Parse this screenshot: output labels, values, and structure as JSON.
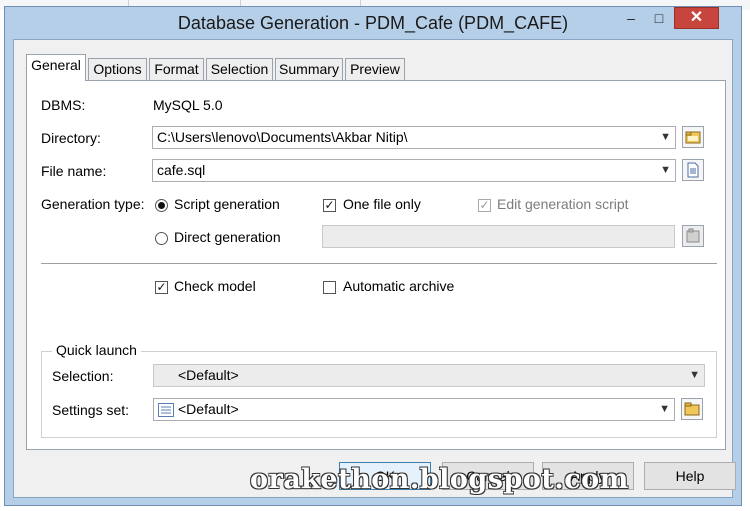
{
  "window": {
    "title": "Database Generation - PDM_Cafe (PDM_CAFE)"
  },
  "titlebar_buttons": {
    "minimize": "–",
    "maximize": "□",
    "close": "✕"
  },
  "tabs": [
    "General",
    "Options",
    "Format",
    "Selection",
    "Summary",
    "Preview"
  ],
  "active_tab": "General",
  "general": {
    "dbms_label": "DBMS:",
    "dbms_value": "MySQL 5.0",
    "directory_label": "Directory:",
    "directory_value": "C:\\Users\\lenovo\\Documents\\Akbar Nitip\\",
    "filename_label": "File name:",
    "filename_value": "cafe.sql",
    "generation_type_label": "Generation type:",
    "script_generation_label": "Script generation",
    "direct_generation_label": "Direct generation",
    "one_file_only_label": "One file only",
    "edit_script_label": "Edit generation script",
    "direct_generation_value": "",
    "check_model_label": "Check model",
    "automatic_archive_label": "Automatic archive"
  },
  "state": {
    "generation_type": "script",
    "one_file_only": true,
    "edit_generation_script": true,
    "edit_generation_script_enabled": false,
    "check_model": true,
    "automatic_archive": false
  },
  "quick_launch": {
    "title": "Quick launch",
    "selection_label": "Selection:",
    "selection_value": "<Default>",
    "settings_label": "Settings set:",
    "settings_value": "<Default>"
  },
  "watermark": "orakethon.blogspot.com",
  "buttons": {
    "ok": "OK",
    "cancel": "Cancel",
    "apply": "Apply",
    "help": "Help"
  },
  "icons": {
    "directory_browse": "folder-browse-icon",
    "file_properties": "document-icon",
    "direct_browse": "connection-icon",
    "settings_list": "list-icon",
    "settings_folder": "folder-icon"
  },
  "colors": {
    "window_frame": "#b6cfe8",
    "close_button": "#c7453c",
    "panel": "#ffffff"
  }
}
